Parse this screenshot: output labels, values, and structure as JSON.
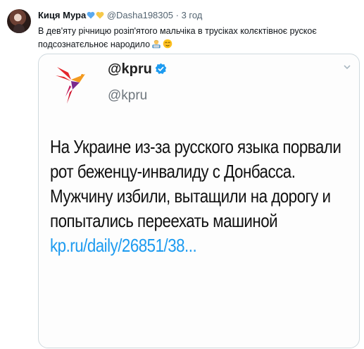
{
  "tweet": {
    "author_name": "Киця Мура",
    "author_hearts": [
      "blue-heart-icon",
      "yellow-heart-icon"
    ],
    "handle": "@Dasha198305",
    "separator": "·",
    "time": "3 год",
    "text": "В дев'яту річницю розіп'ятого мальчіка в трусіках колєктівноє рускоє подсознатєльноє народило",
    "emojis": [
      "man-technologist-icon",
      "relieved-face-icon"
    ]
  },
  "quoted": {
    "name": "@kpru",
    "handle": "@kpru",
    "text": "На Украине из-за русского языка порвали рот беженцу-инвалиду с Донбасса. Мужчину избили, вытащили на дорогу и попытались переехать машиной ",
    "link": "kp.ru/daily/26851/38..."
  },
  "colors": {
    "link": "#1d9bf0",
    "verified": "#1d9bf0",
    "border": "#cfd9de",
    "muted": "#536471"
  }
}
